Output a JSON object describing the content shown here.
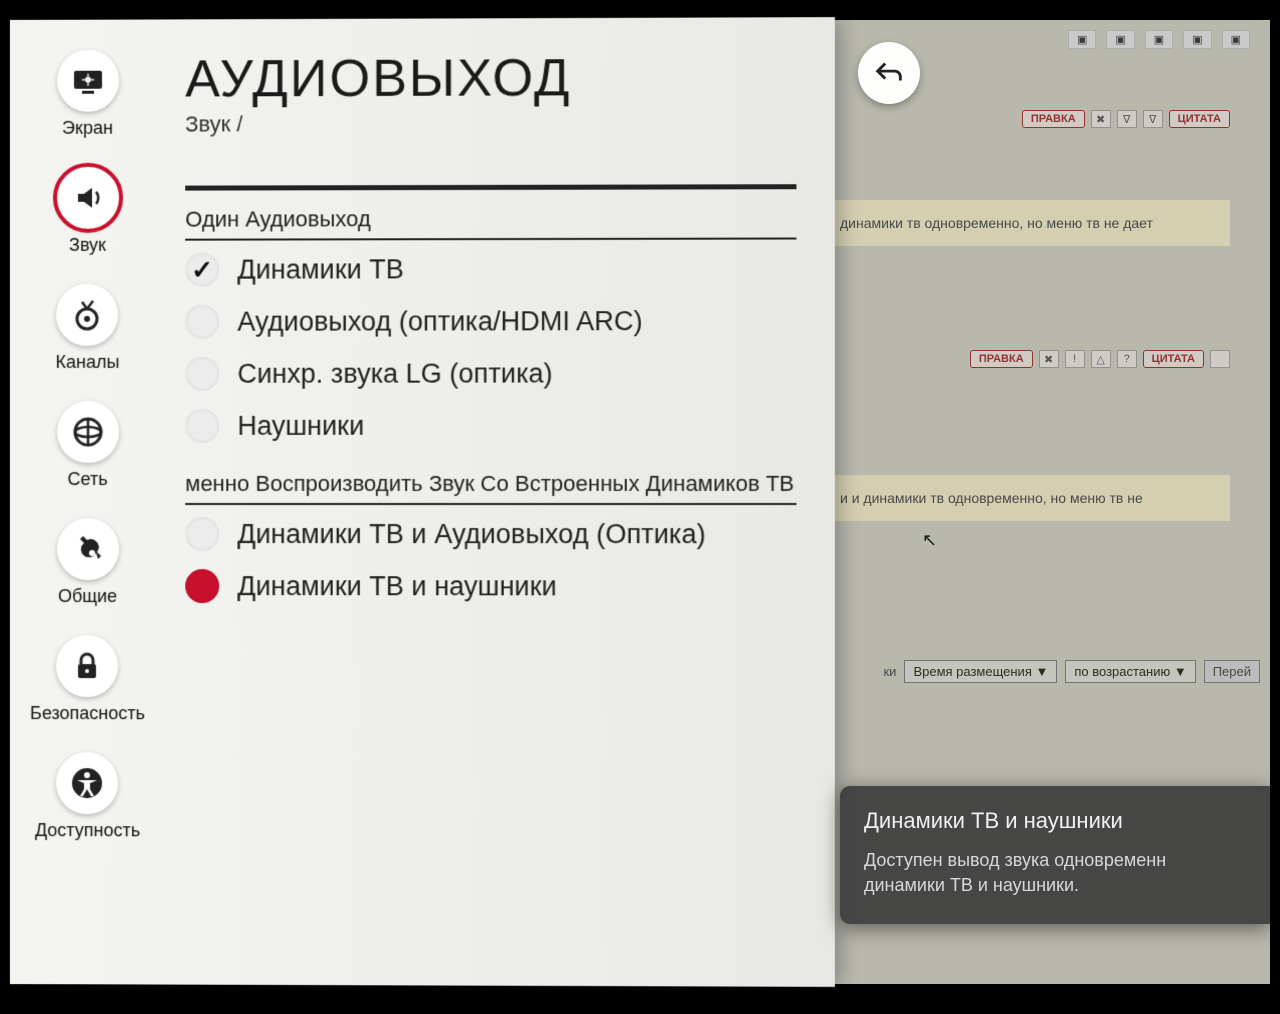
{
  "sidebar": {
    "items": [
      {
        "label": "Экран"
      },
      {
        "label": "Звук"
      },
      {
        "label": "Каналы"
      },
      {
        "label": "Сеть"
      },
      {
        "label": "Общие"
      },
      {
        "label": "Безопасность"
      },
      {
        "label": "Доступность"
      }
    ]
  },
  "main": {
    "title": "АУДИОВЫХОД",
    "breadcrumb": "Звук /",
    "group1_header": "Один Аудиовыход",
    "group1_options": [
      "Динамики ТВ",
      "Аудиовыход (оптика/HDMI ARC)",
      "Синхр. звука LG (оптика)",
      "Наушники"
    ],
    "group2_header": "менно Воспроизводить Звук Со Встроенных Динамиков ТВ",
    "group2_options": [
      "Динамики ТВ и Аудиовыход (Оптика)",
      "Динамики ТВ и наушники"
    ]
  },
  "tooltip": {
    "title": "Динамики ТВ и наушники",
    "body": "Доступен вывод звука одновременн динамики ТВ и наушники."
  },
  "bg": {
    "pill_edit": "ПРАВКА",
    "pill_quote": "ЦИТАТА",
    "quote1": "динамики тв одновременно, но меню тв не дает",
    "quote2": "и и динамики тв одновременно, но меню тв не",
    "select_label": "ки",
    "select_time": "Время размещения  ▼",
    "select_order": "по возрастанию  ▼",
    "btn_go": "Перей"
  }
}
